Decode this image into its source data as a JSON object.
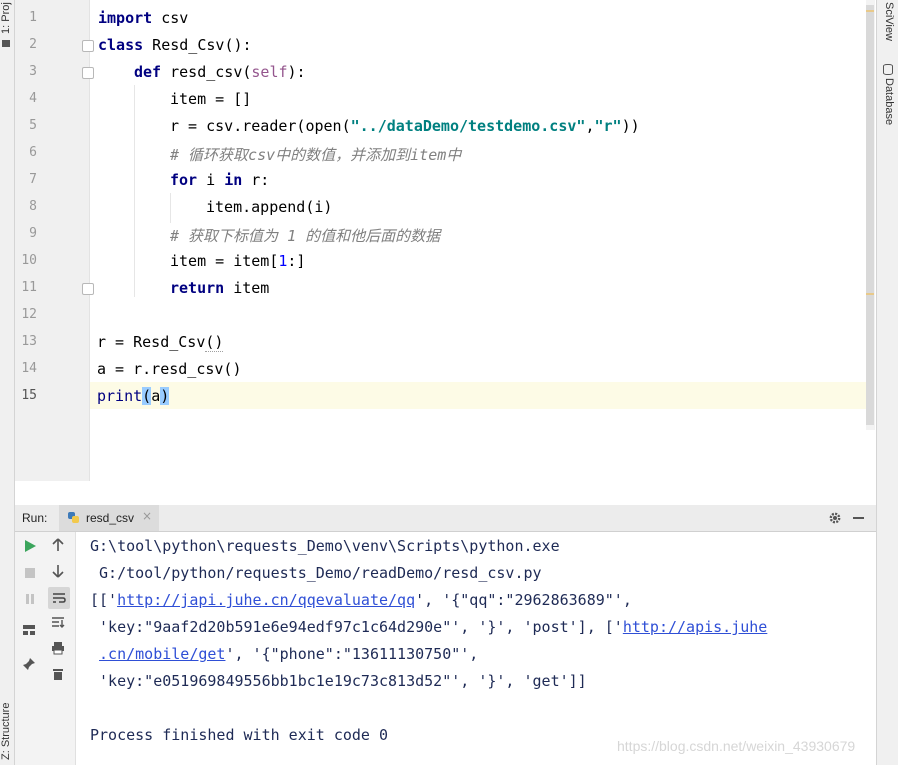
{
  "side_panels": {
    "project_tab": "1: Proj",
    "structure_tab": "Z: Structure",
    "sciview_tab": "SciView",
    "database_tab": "Database"
  },
  "editor": {
    "line_numbers": [
      "1",
      "2",
      "3",
      "4",
      "5",
      "6",
      "7",
      "8",
      "9",
      "10",
      "11",
      "12",
      "13",
      "14",
      "15"
    ],
    "current_line": "15",
    "code": {
      "l1_kw": "import",
      "l1_rest": " csv",
      "l2_kw": "class",
      "l2_name": " Resd_Csv",
      "l2_rest": "():",
      "l3_kw": "def",
      "l3_name": " resd_csv(",
      "l3_self": "self",
      "l3_rest": "):",
      "l4": "item = []",
      "l5_a": "r = csv.reader(open(",
      "l5_str1": "\"../dataDemo/testdemo.csv\"",
      "l5_comma": ",",
      "l5_str2": "\"r\"",
      "l5_end": "))",
      "l6": "# 循环获取csv中的数值，并添加到item中",
      "l7_kw1": "for",
      "l7_mid": " i ",
      "l7_kw2": "in",
      "l7_rest": " r:",
      "l8": "item.append(i)",
      "l9": "# 获取下标值为 1 的值和他后面的数据",
      "l10_a": "item = item[",
      "l10_num": "1",
      "l10_b": ":]",
      "l11_kw": "return",
      "l11_rest": " item",
      "l13_a": "r = ",
      "l13_b": "Resd_Csv",
      "l13_c": "()",
      "l14": "a = r.resd_csv()",
      "l15_a": "print",
      "l15_b": "(",
      "l15_c": "a",
      "l15_d": ")"
    }
  },
  "run_panel": {
    "label": "Run:",
    "tab_name": "resd_csv",
    "tab_close": "×",
    "settings_icon": "gear-icon",
    "minimize_icon": "minus-icon",
    "output": {
      "line1": "G:\\tool\\python\\requests_Demo\\venv\\Scripts\\python.exe",
      "line2": " G:/tool/python/requests_Demo/readDemo/resd_csv.py",
      "line3_a": "[['",
      "line3_link": "http://japi.juhe.cn/qqevaluate/qq",
      "line3_b": "', '{\"qq\":\"2962863689\"',",
      "line4_a": " 'key:\"9aaf2d20b591e6e94edf97c1c64d290e\"', '}', 'post'], ['",
      "line4_link": "http://apis.juhe",
      "line5_link": ".cn/mobile/get",
      "line5_b": "', '{\"phone\":\"13611130750\"',",
      "line6": " 'key:\"e051969849556bb1bc1e19c73c813d52\"', '}', 'get']]",
      "line8": "Process finished with exit code 0"
    }
  },
  "watermark": "https://blog.csdn.net/weixin_43930679"
}
